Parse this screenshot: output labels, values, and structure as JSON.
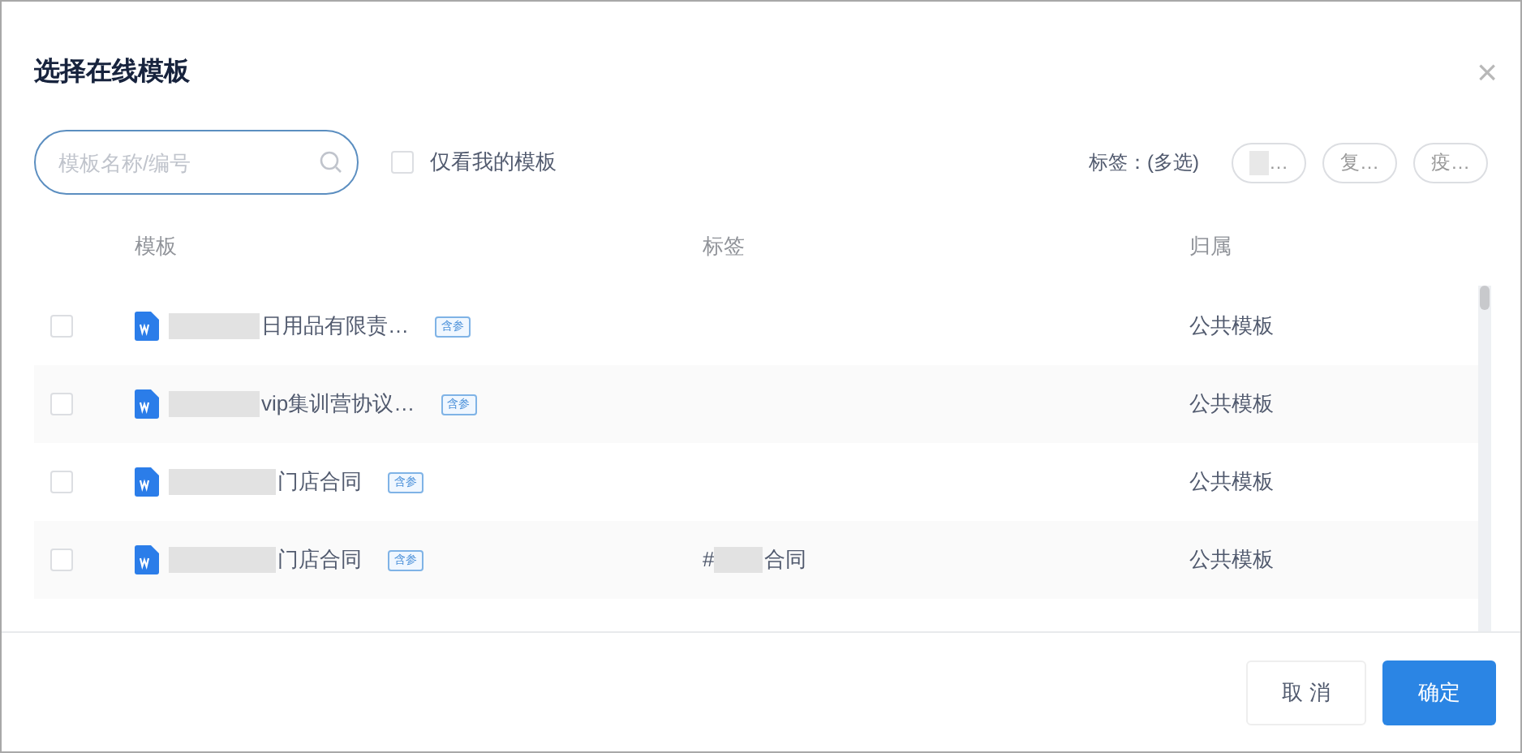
{
  "dialog": {
    "title": "选择在线模板",
    "close": "×"
  },
  "search": {
    "placeholder": "模板名称/编号"
  },
  "only_mine": {
    "label": "仅看我的模板",
    "checked": false
  },
  "tags_filter": {
    "label": "标签：(多选)",
    "chips": [
      {
        "text": "…",
        "redacted": true,
        "selected": false
      },
      {
        "text": "复…",
        "redacted": false,
        "selected": false
      },
      {
        "text": "疫…",
        "redacted": false,
        "selected": false
      }
    ]
  },
  "table": {
    "columns": [
      "模板",
      "标签",
      "归属"
    ],
    "rows": [
      {
        "checked": false,
        "redacted_prefix": true,
        "name": "日用品有限责…",
        "badge": "含参",
        "tag": [],
        "owner": "公共模板"
      },
      {
        "checked": false,
        "redacted_prefix": true,
        "name": "vip集训营协议…",
        "badge": "含参",
        "tag": [],
        "owner": "公共模板"
      },
      {
        "checked": false,
        "redacted_prefix": true,
        "name": "门店合同",
        "badge": "含参",
        "tag": [],
        "owner": "公共模板"
      },
      {
        "checked": false,
        "redacted_prefix": true,
        "name": "门店合同",
        "badge": "含参",
        "tag": [
          "#",
          "合同"
        ],
        "owner": "公共模板"
      }
    ]
  },
  "buttons": {
    "cancel": "取 消",
    "confirm": "确定"
  }
}
